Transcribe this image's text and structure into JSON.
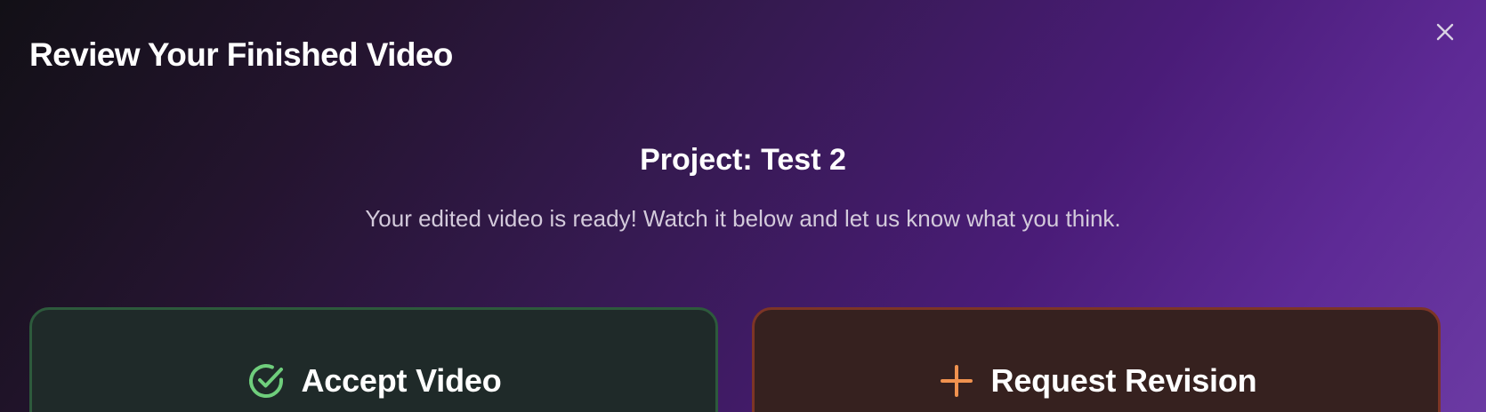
{
  "modal": {
    "title": "Review Your Finished Video",
    "close_icon": "close-icon"
  },
  "project": {
    "title": "Project: Test 2",
    "subtitle": "Your edited video is ready! Watch it below and let us know what you think."
  },
  "actions": {
    "accept": {
      "label": "Accept Video",
      "icon": "check-circle-icon",
      "color": "#6fce7c"
    },
    "revision": {
      "label": "Request Revision",
      "icon": "plus-icon",
      "color": "#f0924f"
    }
  },
  "colors": {
    "accent_purple": "#5e2a96",
    "accept_border": "#2d5a3c",
    "revision_border": "#7d3526"
  }
}
